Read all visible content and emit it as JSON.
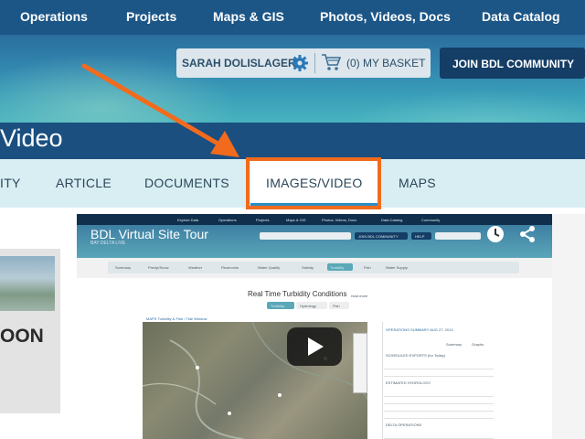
{
  "topnav": {
    "items": [
      "Operations",
      "Projects",
      "Maps & GIS",
      "Photos, Videos, Docs",
      "Data Catalog"
    ]
  },
  "header": {
    "user_name": "SARAH DOLISLAGER",
    "basket": "(0) MY BASKET",
    "join_label": "JOIN BDL COMMUNITY"
  },
  "page": {
    "title": "Video"
  },
  "tabs": {
    "items": [
      "ITY",
      "ARTICLE",
      "DOCUMENTS",
      "IMAGES/VIDEO",
      "MAPS"
    ],
    "active": "IMAGES/VIDEO"
  },
  "left_card": {
    "caption": "OON"
  },
  "video": {
    "title": "BDL Virtual Site Tour",
    "subtitle": "BAY DELTA LIVE",
    "inner_nav": [
      "Explore Data",
      "Operations",
      "Projects",
      "Maps & GIS",
      "Photos, Videos, Docs",
      "Data Catalog",
      "Community"
    ],
    "inner_tabs": [
      "Summary",
      "Precip/Snow",
      "Weather",
      "Reservoirs",
      "Water Quality",
      "Salinity",
      "Turbidity",
      "Fish",
      "Water Supply"
    ],
    "chart_title": "Real Time Turbidity Conditions",
    "chart_title_note": "read more",
    "subtabs": [
      "Turbidity",
      "Hydrology",
      "Fish"
    ],
    "map_label": "MAPS Turbidity & FIsh / Tide Window",
    "panel_title": "OPERATIONS SUMMARY AUG 27, 2013",
    "panel_tabs": [
      "Summary",
      "Graphs"
    ],
    "panel_sections": [
      "SCHEDULED EXPORTS (for Today)",
      "ESTIMATED HYDROLOGY",
      "DELTA OPERATIONS"
    ],
    "inner_join": "JOIN BDL COMMUNITY",
    "inner_help": "HELP"
  },
  "colors": {
    "nav_bg": "#1c5687",
    "title_bg": "#1a4f80",
    "tabs_bg": "#d9eef3",
    "highlight": "#f26b1d",
    "active_tab_underline": "#2d8dc6"
  }
}
